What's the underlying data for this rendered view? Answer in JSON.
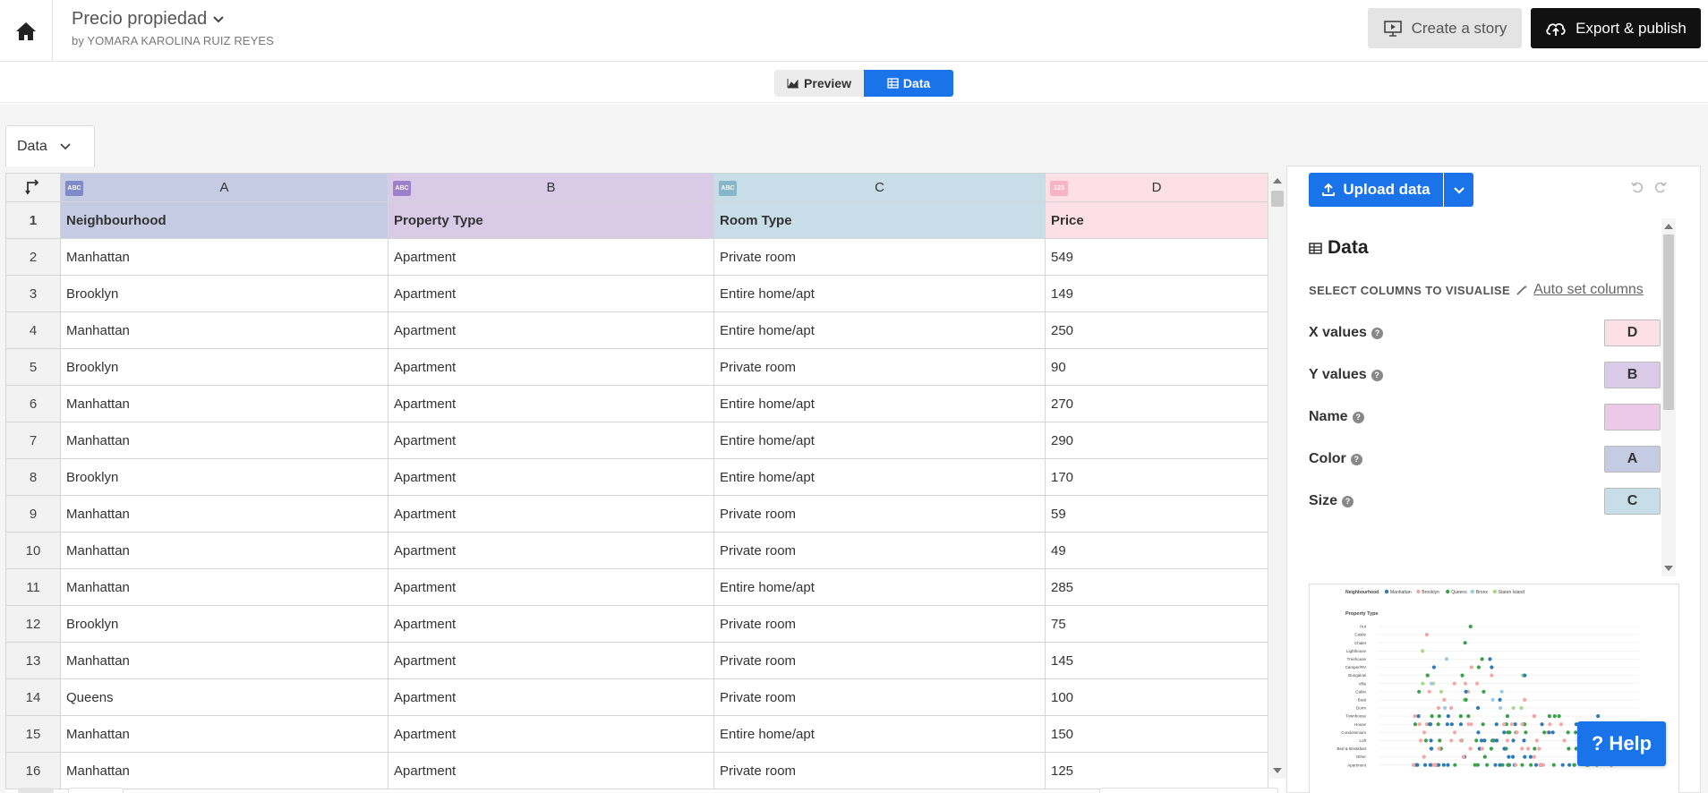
{
  "header": {
    "title": "Precio propiedad",
    "author": "by YOMARA KAROLINA RUIZ REYES",
    "story_label": "Create a story",
    "export_label": "Export & publish",
    "icons": [
      "home-icon",
      "chevron-down-icon",
      "presentation-icon",
      "cloud-upload-icon"
    ]
  },
  "view_toggle": {
    "preview_label": "Preview",
    "data_label": "Data",
    "active": "Data"
  },
  "sheet": {
    "tab_label": "Data"
  },
  "columns": [
    {
      "letter": "A",
      "type_badge": "ABC",
      "color": "#c5cbe3"
    },
    {
      "letter": "B",
      "type_badge": "ABC",
      "color": "#d9cbe8"
    },
    {
      "letter": "C",
      "type_badge": "ABC",
      "color": "#c7dde8"
    },
    {
      "letter": "D",
      "type_badge": "123",
      "color": "#fde0e6"
    }
  ],
  "header_row": {
    "num": "1",
    "cells": [
      "Neighbourhood",
      "Property Type",
      "Room Type",
      "Price"
    ]
  },
  "rows": [
    {
      "num": "2",
      "cells": [
        "Manhattan",
        "Apartment",
        "Private room",
        "549"
      ]
    },
    {
      "num": "3",
      "cells": [
        "Brooklyn",
        "Apartment",
        "Entire home/apt",
        "149"
      ]
    },
    {
      "num": "4",
      "cells": [
        "Manhattan",
        "Apartment",
        "Entire home/apt",
        "250"
      ]
    },
    {
      "num": "5",
      "cells": [
        "Brooklyn",
        "Apartment",
        "Private room",
        "90"
      ]
    },
    {
      "num": "6",
      "cells": [
        "Manhattan",
        "Apartment",
        "Entire home/apt",
        "270"
      ]
    },
    {
      "num": "7",
      "cells": [
        "Manhattan",
        "Apartment",
        "Entire home/apt",
        "290"
      ]
    },
    {
      "num": "8",
      "cells": [
        "Brooklyn",
        "Apartment",
        "Entire home/apt",
        "170"
      ]
    },
    {
      "num": "9",
      "cells": [
        "Manhattan",
        "Apartment",
        "Private room",
        "59"
      ]
    },
    {
      "num": "10",
      "cells": [
        "Manhattan",
        "Apartment",
        "Private room",
        "49"
      ]
    },
    {
      "num": "11",
      "cells": [
        "Manhattan",
        "Apartment",
        "Entire home/apt",
        "285"
      ]
    },
    {
      "num": "12",
      "cells": [
        "Brooklyn",
        "Apartment",
        "Private room",
        "75"
      ]
    },
    {
      "num": "13",
      "cells": [
        "Manhattan",
        "Apartment",
        "Private room",
        "145"
      ]
    },
    {
      "num": "14",
      "cells": [
        "Queens",
        "Apartment",
        "Private room",
        "100"
      ]
    },
    {
      "num": "15",
      "cells": [
        "Manhattan",
        "Apartment",
        "Entire home/apt",
        "150"
      ]
    },
    {
      "num": "16",
      "cells": [
        "Manhattan",
        "Apartment",
        "Private room",
        "125"
      ]
    }
  ],
  "panel": {
    "upload_label": "Upload data",
    "section_title": "Data",
    "select_label": "SELECT COLUMNS TO VISUALISE",
    "auto_set_label": "Auto set columns",
    "bindings": [
      {
        "label": "X values",
        "column": "D",
        "color": "#fde0e6"
      },
      {
        "label": "Y values",
        "column": "B",
        "color": "#d9cbe8"
      },
      {
        "label": "Name",
        "column": "",
        "color": "#ecc9e6"
      },
      {
        "label": "Color",
        "column": "A",
        "color": "#c5cbe3"
      },
      {
        "label": "Size",
        "column": "C",
        "color": "#c7dde8"
      }
    ]
  },
  "thumbnail": {
    "legend_title": "Neighbourhood",
    "legend": [
      {
        "name": "Manhattan",
        "color": "#2c7bb6"
      },
      {
        "name": "Brooklyn",
        "color": "#f4a6a6"
      },
      {
        "name": "Queens",
        "color": "#3aa04a"
      },
      {
        "name": "Bronx",
        "color": "#9ec9e2"
      },
      {
        "name": "Staten Island",
        "color": "#a6d98a"
      }
    ],
    "y_title": "Property Type",
    "categories": [
      "Hut",
      "Castle",
      "Chalet",
      "Lighthouse",
      "Treehouse",
      "Camper/RV",
      "Bungalow",
      "Villa",
      "Cabin",
      "Boat",
      "Dorm",
      "Townhouse",
      "House",
      "Condominium",
      "Loft",
      "Bed & Breakfast",
      "Other",
      "Apartment"
    ]
  },
  "help_label": "? Help"
}
